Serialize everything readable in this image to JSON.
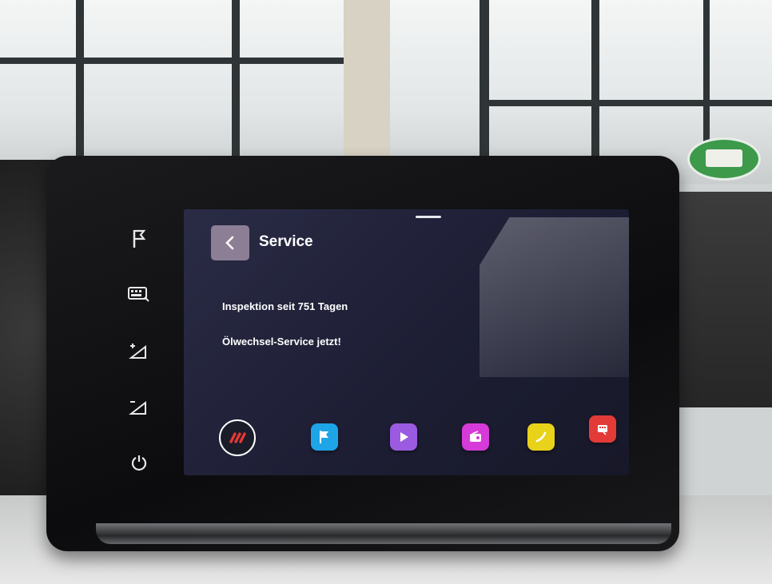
{
  "screen": {
    "title": "Service",
    "messages": [
      "Inspektion seit 751 Tagen",
      "Ölwechsel-Service jetzt!"
    ]
  },
  "icons": {
    "back": "chevron-left-icon",
    "side_keys": [
      "flag-icon",
      "keyboard-icon",
      "volume-up-icon",
      "volume-down-icon",
      "power-icon"
    ],
    "dock": [
      "home-icon",
      "navigation-flag-icon",
      "media-play-icon",
      "radio-icon",
      "phone-icon",
      "car-settings-icon"
    ]
  },
  "colors": {
    "back_button": "#8c7f95",
    "home_accent": "#e53935",
    "nav_app": "#1ea5e8",
    "media_app": "#9b5be0",
    "radio_app": "#d63ad8",
    "phone_app": "#e8d21a",
    "car_app": "#e23b37"
  }
}
